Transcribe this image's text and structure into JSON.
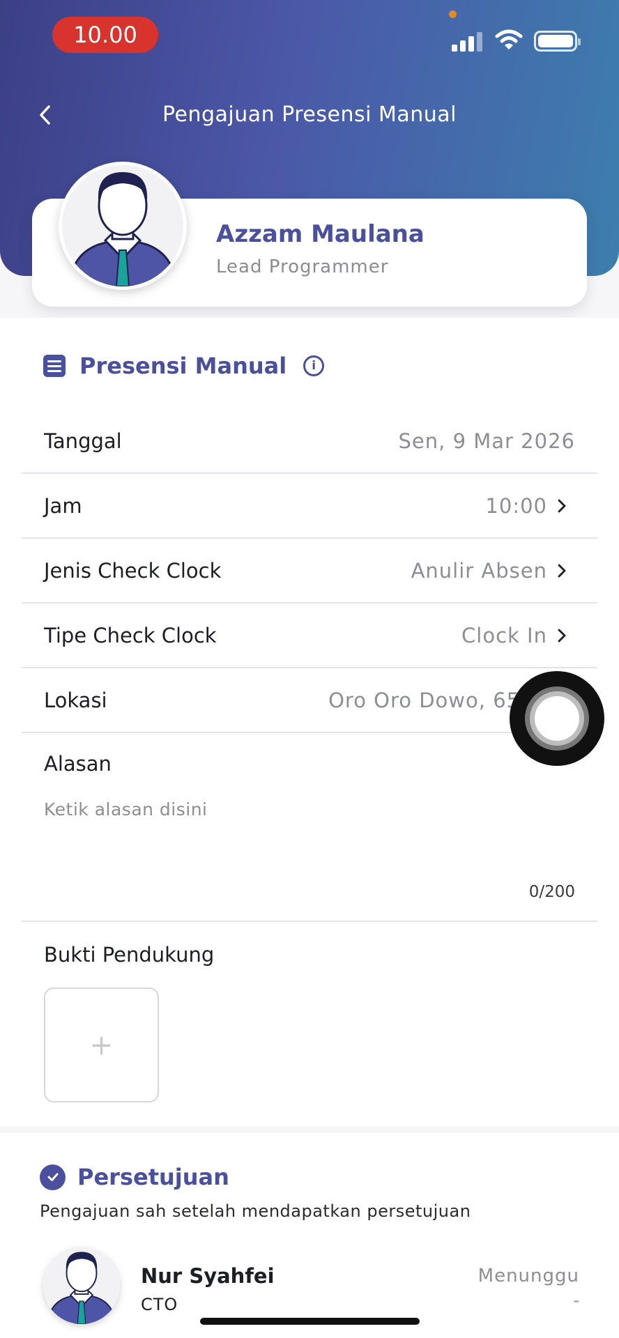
{
  "status_bar": {
    "time": "10.00"
  },
  "header": {
    "title": "Pengajuan Presensi Manual"
  },
  "profile": {
    "name": "Azzam Maulana",
    "role": "Lead Programmer"
  },
  "form": {
    "section_title": "Presensi Manual",
    "rows": [
      {
        "label": "Tanggal",
        "value": "Sen, 9 Mar 2026"
      },
      {
        "label": "Jam",
        "value": "10:00"
      },
      {
        "label": "Jenis Check Clock",
        "value": "Anulir Absen"
      },
      {
        "label": "Tipe Check Clock",
        "value": "Clock In"
      },
      {
        "label": "Lokasi",
        "value": "Oro Oro Dowo, 6511"
      }
    ],
    "reason_label": "Alasan",
    "reason_placeholder": "Ketik alasan disini",
    "reason_counter": "0/200",
    "evidence_label": "Bukti Pendukung",
    "evidence_add": "+"
  },
  "approval": {
    "title": "Persetujuan",
    "subtitle": "Pengajuan sah setelah mendapatkan persetujuan",
    "approvers": [
      {
        "name": "Nur Syahfei",
        "role": "CTO",
        "status": "Menunggu",
        "detail": "-"
      }
    ]
  }
}
